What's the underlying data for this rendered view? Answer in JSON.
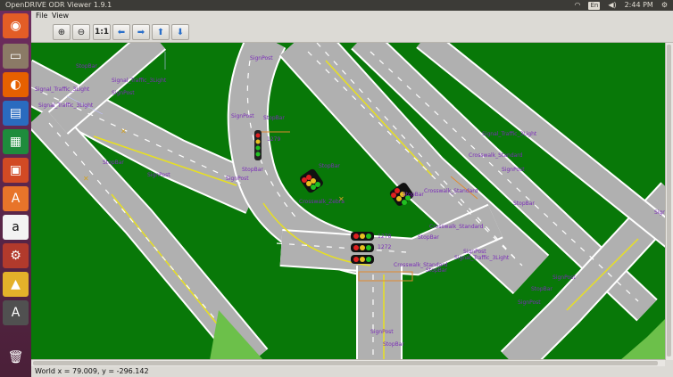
{
  "window": {
    "title": "OpenDRIVE ODR Viewer 1.9.1"
  },
  "tray": {
    "wifi_icon": "wifi-icon",
    "lang": "En",
    "sound_icon": "speaker-icon",
    "time": "2:44 PM",
    "power_icon": "gear-icon"
  },
  "launcher": [
    {
      "name": "ubuntu-icon",
      "glyph": "◉",
      "bg": "#e35d26"
    },
    {
      "name": "files-icon",
      "glyph": "▭",
      "bg": "#8b7a66"
    },
    {
      "name": "firefox-icon",
      "glyph": "◐",
      "bg": "#e66000"
    },
    {
      "name": "writer-icon",
      "glyph": "▤",
      "bg": "#2a6bbf"
    },
    {
      "name": "calc-icon",
      "glyph": "▦",
      "bg": "#1e8c3c"
    },
    {
      "name": "impress-icon",
      "glyph": "▣",
      "bg": "#d24a24"
    },
    {
      "name": "software-center-icon",
      "glyph": "A",
      "bg": "#e8742a"
    },
    {
      "name": "amazon-icon",
      "glyph": "a",
      "bg": "#f3f3f3"
    },
    {
      "name": "settings-icon",
      "glyph": "⚙",
      "bg": "#b23a2c"
    },
    {
      "name": "odr-viewer-icon",
      "glyph": "▲",
      "bg": "#e4b12a"
    },
    {
      "name": "updater-icon",
      "glyph": "A",
      "bg": "#505050"
    },
    {
      "name": "trash-icon",
      "glyph": "🗑",
      "bg": "transparent"
    }
  ],
  "menu": {
    "file": "File",
    "view": "View"
  },
  "toolbar": {
    "one_to_one": "1:1"
  },
  "labels": {
    "stopbar": "StopBar",
    "signal_traffic": "Signal_Traffic_3Light",
    "signpost": "SignPost",
    "crosswalk_zebra": "Crosswalk_Zebra",
    "crosswalk_standard": "Crosswalk_Standard",
    "id_1278": "1278",
    "id_1272": "1272",
    "id_1279": "1279"
  },
  "status": {
    "coords": "World x = 79.009, y = -296.142"
  }
}
